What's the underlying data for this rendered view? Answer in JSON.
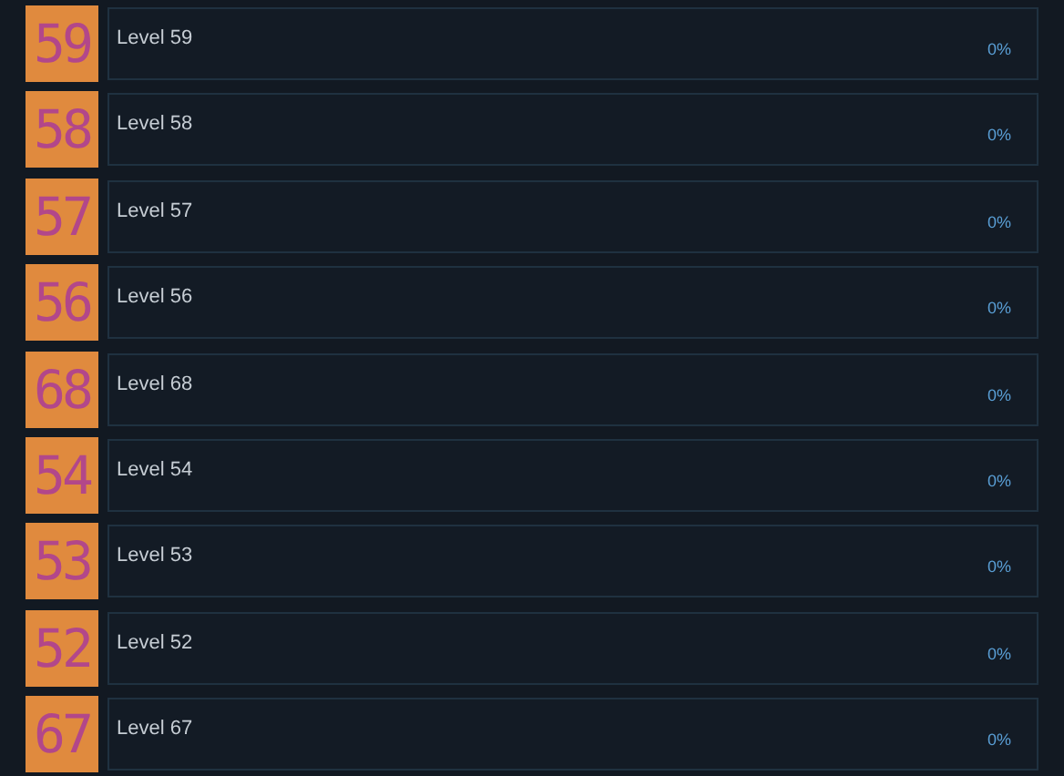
{
  "achievements": [
    {
      "icon_text": "59",
      "title": "Level 59",
      "percent": "0%"
    },
    {
      "icon_text": "58",
      "title": "Level 58",
      "percent": "0%"
    },
    {
      "icon_text": "57",
      "title": "Level 57",
      "percent": "0%"
    },
    {
      "icon_text": "56",
      "title": "Level 56",
      "percent": "0%"
    },
    {
      "icon_text": "68",
      "title": "Level 68",
      "percent": "0%"
    },
    {
      "icon_text": "54",
      "title": "Level 54",
      "percent": "0%"
    },
    {
      "icon_text": "53",
      "title": "Level 53",
      "percent": "0%"
    },
    {
      "icon_text": "52",
      "title": "Level 52",
      "percent": "0%"
    },
    {
      "icon_text": "67",
      "title": "Level 67",
      "percent": "0%"
    }
  ]
}
